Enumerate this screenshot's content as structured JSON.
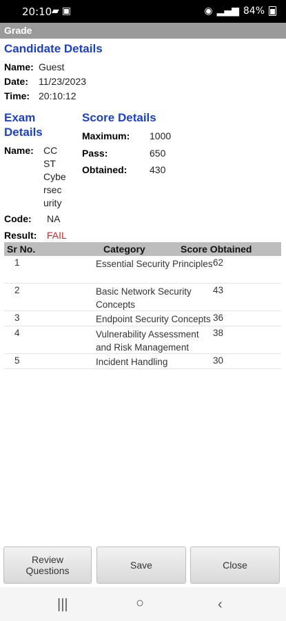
{
  "status": {
    "time": "20:10",
    "battery": "84%"
  },
  "window": {
    "title": "Grade"
  },
  "candidate": {
    "heading": "Candidate Details",
    "name_label": "Name:",
    "name_value": "Guest",
    "date_label": "Date:",
    "date_value": "11/23/2023",
    "time_label": "Time:",
    "time_value": "20:10:12"
  },
  "exam": {
    "heading_line1": "Exam",
    "heading_line2": "Details",
    "name_label": "Name:",
    "name_lines": [
      "CC",
      "ST",
      "Cybe",
      "rsec",
      "urity"
    ],
    "code_label": "Code:",
    "code_value": "NA",
    "result_label": "Result:",
    "result_value": "FAIL"
  },
  "score": {
    "heading": "Score Details",
    "maximum_label": "Maximum:",
    "maximum_value": "1000",
    "pass_label": "Pass:",
    "pass_value": "650",
    "obtained_label": "Obtained:",
    "obtained_value": "430"
  },
  "table": {
    "headers": [
      "Sr No.",
      "Category",
      "Score Obtained"
    ],
    "rows": [
      {
        "sr": "1",
        "category": "Essential Security Principles",
        "score": "62"
      },
      {
        "sr": "2",
        "category": "Basic Network Security Concepts",
        "score": "43"
      },
      {
        "sr": "3",
        "category": "Endpoint Security Concepts",
        "score": "36"
      },
      {
        "sr": "4",
        "category": "Vulnerability Assessment and Risk Management",
        "score": "38"
      },
      {
        "sr": "5",
        "category": "Incident Handling",
        "score": "30"
      }
    ]
  },
  "buttons": {
    "review": "Review Questions",
    "save": "Save",
    "close": "Close"
  }
}
